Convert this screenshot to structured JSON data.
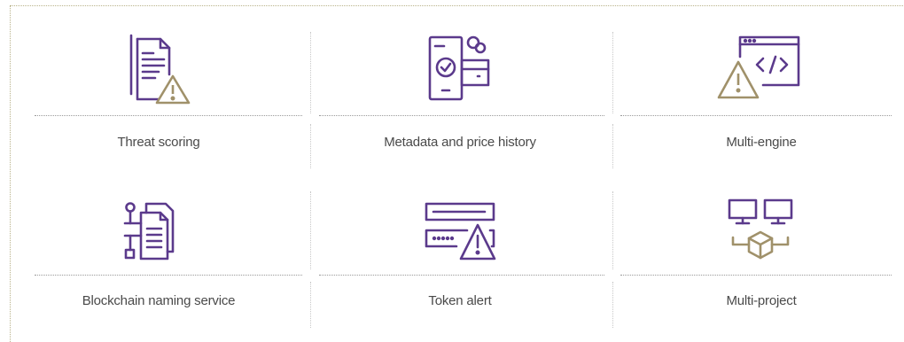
{
  "colors": {
    "primary": "#5b3a8c",
    "accent": "#a0916a",
    "text": "#4a4a4a",
    "divider": "#9a9a9a"
  },
  "features": [
    {
      "label": "Threat scoring",
      "icon": "threat-scoring-icon"
    },
    {
      "label": "Metadata and price history",
      "icon": "metadata-price-history-icon"
    },
    {
      "label": "Multi-engine",
      "icon": "multi-engine-icon"
    },
    {
      "label": "Blockchain naming service",
      "icon": "blockchain-naming-service-icon"
    },
    {
      "label": "Token alert",
      "icon": "token-alert-icon"
    },
    {
      "label": "Multi-project",
      "icon": "multi-project-icon"
    }
  ]
}
